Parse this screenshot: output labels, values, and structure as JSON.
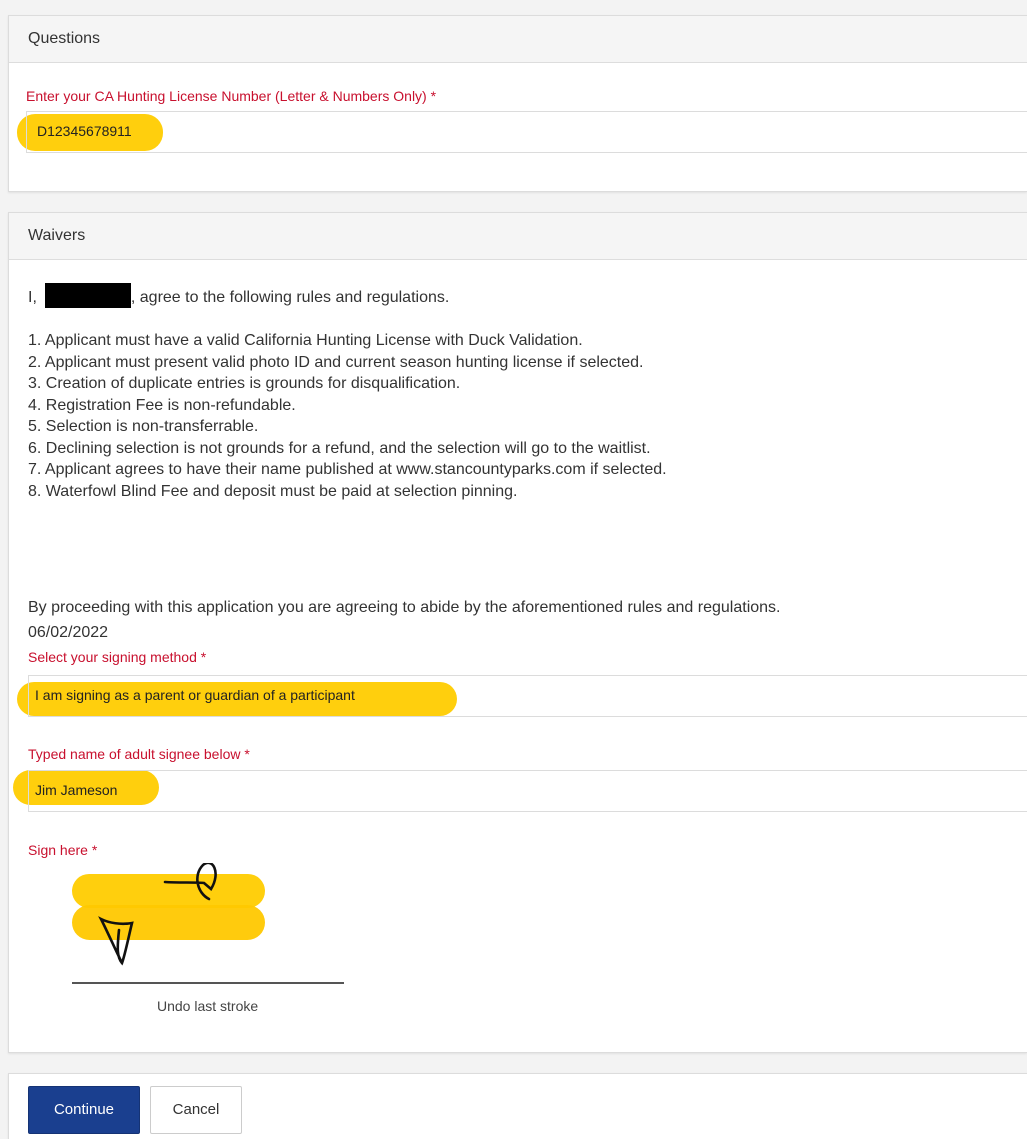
{
  "questions": {
    "heading": "Questions",
    "license_label": "Enter your CA Hunting License Number (Letter & Numbers Only) *",
    "license_value": "D12345678911"
  },
  "waivers": {
    "heading": "Waivers",
    "agree_prefix": "I,",
    "agree_suffix": ", agree to the following rules and regulations.",
    "rules": [
      "1. Applicant must have a valid California Hunting License with Duck Validation.",
      "2. Applicant must present valid photo ID and current season hunting license if selected.",
      "3. Creation of duplicate entries is grounds for disqualification.",
      "4. Registration Fee is non-refundable.",
      "5. Selection is non-transferrable.",
      "6. Declining selection is not grounds for a refund, and the selection will go to the waitlist.",
      "7. Applicant agrees to have their name published at www.stancountyparks.com if selected.",
      "8. Waterfowl Blind Fee and deposit must be paid at selection pinning."
    ],
    "closing": "By proceeding with this application you are agreeing to abide by the aforementioned rules and regulations.",
    "date": "06/02/2022",
    "signing_method_label": "Select your signing method *",
    "signing_method_value": "I am signing as a parent or guardian of a participant",
    "typed_name_label": "Typed name of adult signee below *",
    "typed_name_value": "Jim Jameson",
    "sign_label": "Sign here *",
    "undo_label": "Undo last stroke"
  },
  "footer": {
    "continue_label": "Continue",
    "cancel_label": "Cancel"
  },
  "colors": {
    "required_label": "#c8102e",
    "highlight": "#ffcc00",
    "primary_button": "#1a3f8f"
  }
}
